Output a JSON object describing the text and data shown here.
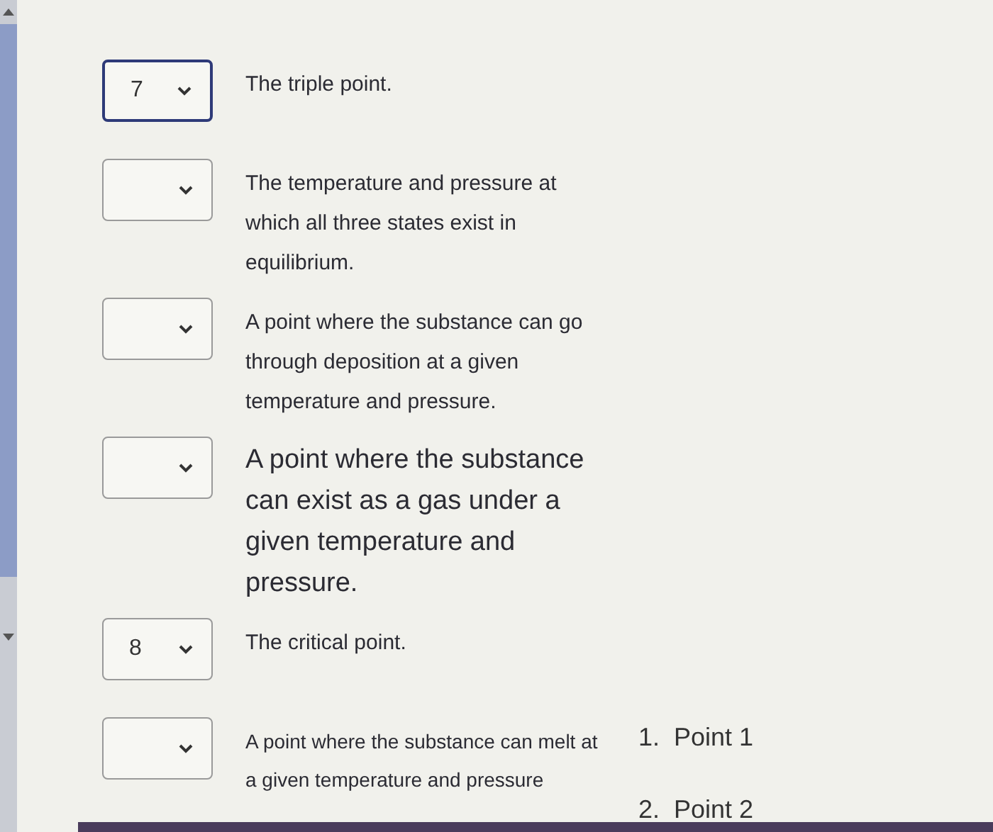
{
  "matches": [
    {
      "value": "7",
      "focused": true,
      "kind": "normal",
      "text": "The triple point."
    },
    {
      "focused": false,
      "kind": "normal",
      "text": "The temperature and pressure at which all three states exist in equilibrium."
    },
    {
      "focused": false,
      "kind": "normal",
      "text": "A point where the substance can go through deposition at a given temperature and pressure."
    },
    {
      "focused": false,
      "kind": "large",
      "text": "A point where the substance can exist as a gas under a given temperature and pressure."
    },
    {
      "value": "8",
      "focused": false,
      "kind": "normal",
      "text": "The critical point."
    },
    {
      "focused": false,
      "kind": "small",
      "text": "A point where the substance can melt at a given temperature and pressure"
    }
  ],
  "answer_list": [
    {
      "number": "1.",
      "label": "Point 1"
    },
    {
      "number": "2.",
      "label": "Point 2"
    }
  ]
}
